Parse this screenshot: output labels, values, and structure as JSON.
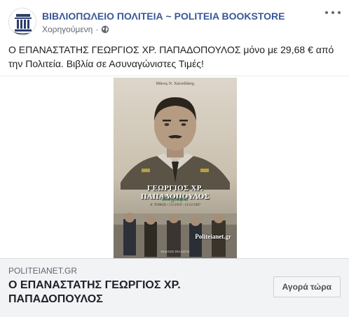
{
  "post": {
    "page_name": "ΒΙΒΛΙΟΠΩΛΕΙΟ ΠΟΛΙΤΕΙΑ ~ POLITEIA BOOKSTORE",
    "sponsored_label": "Χορηγούμενη",
    "separator": "·",
    "more_icon": "more-options-icon",
    "audience_icon": "globe-icon",
    "caption": "Ο ΕΠΑΝΑΣΤΑΤΗΣ ΓΕΩΡΓΙΟΣ ΧΡ. ΠΑΠΑΔΟΠΟΥΛΟΣ μόνο με 29,68 € από την Πολιτεία. Βιβλία σε Ασυναγώνιστες Τιμές!"
  },
  "book_cover": {
    "author": "Μάνος Ν. Χατσιδάκης",
    "title": "ΓΕΩΡΓΙΟΣ ΧΡ. ΠΑΠΑΔΟΠΟΥΛΟΣ",
    "subtitle": "Βιογραφία",
    "volume": "Α' ΤΟΜΟΣ • 5/5/1919 - 13/12/1967",
    "watermark": "Politeianet.gr",
    "publisher": "ΕΚΔΟΣΕΙΣ ΠΕΛΑΣΓΟΣ"
  },
  "link": {
    "domain": "POLITEIANET.GR",
    "headline": "Ο ΕΠΑΝΑΣΤΑΤΗΣ ΓΕΩΡΓΙΟΣ ΧΡ. ΠΑΠΑΔΟΠΟΥΛΟΣ",
    "cta_label": "Αγορά τώρα"
  },
  "colors": {
    "page_name": "#385898",
    "meta_text": "#606770",
    "link_bg": "#f2f3f5"
  }
}
